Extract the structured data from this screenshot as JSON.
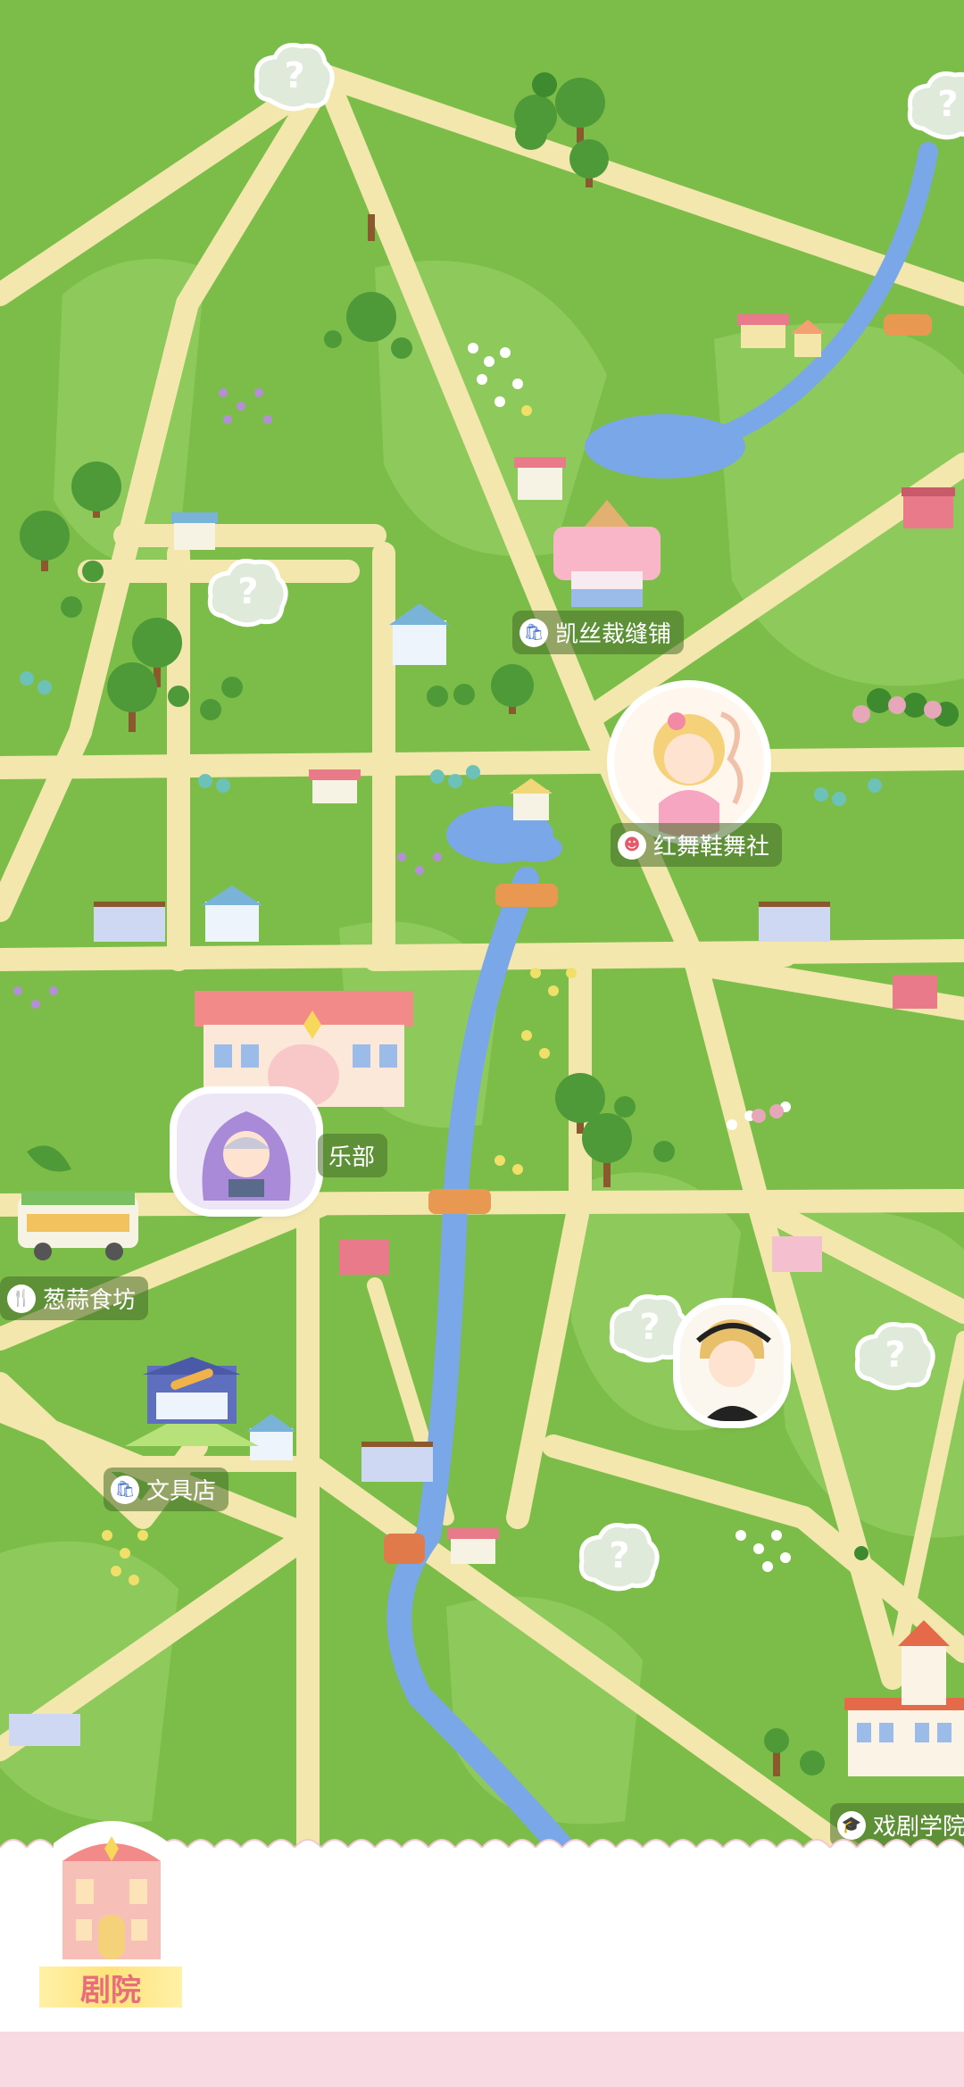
{
  "locations": {
    "tailor": "凯丝裁缝铺",
    "dance_shoes": "红舞鞋舞社",
    "club": "乐部",
    "food": "葱蒜食坊",
    "stationery": "文具店",
    "drama_school": "戏剧学院"
  },
  "unknown_marker": "?",
  "bottom_bar": {
    "theatre_label": "剧院"
  },
  "icons": {
    "shop": "shopping-bag-icon",
    "dance": "masks-icon",
    "food": "fork-knife-icon",
    "school": "graduation-cap-icon",
    "mystery": "question-cloud-icon"
  },
  "colors": {
    "grass": "#7cbd4a",
    "grass_light": "#92cc5e",
    "road": "#f3e7ae",
    "river": "#7aa7e8",
    "label_bg": "#466e28",
    "panel": "#ffffff",
    "panel_strip": "#f8dbe2",
    "theatre_label": "#e86c7b"
  }
}
